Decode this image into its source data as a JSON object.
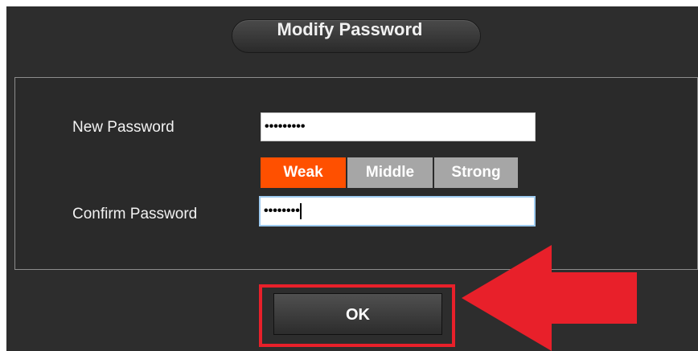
{
  "dialog": {
    "title": "Modify Password"
  },
  "form": {
    "new_password_label": "New Password",
    "new_password_value": "•••••••••",
    "confirm_password_label": "Confirm Password",
    "confirm_password_value": "••••••••"
  },
  "strength": {
    "levels": [
      "Weak",
      "Middle",
      "Strong"
    ],
    "current": "Weak",
    "colors": {
      "active": "#ff5000",
      "inactive": "#a6a6a6"
    }
  },
  "footer": {
    "ok_label": "OK"
  },
  "annotations": {
    "highlight_color": "#e8202a",
    "arrow_icon": "red-arrow-left-icon"
  }
}
